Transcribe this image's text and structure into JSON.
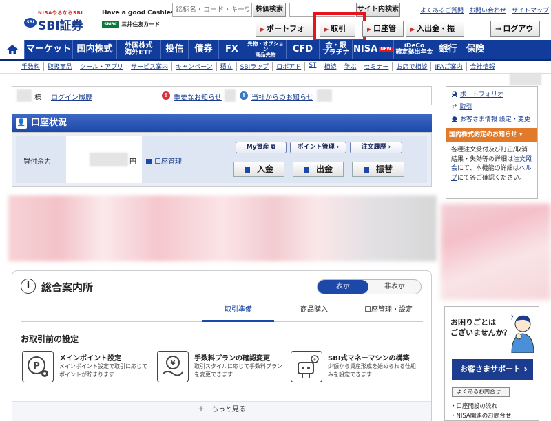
{
  "header": {
    "logo_tag": "NISAやるならSBI",
    "logo_badge": "SBI",
    "logo_name": "SBI証券",
    "cashless": "Have a good Cashless.",
    "smbc_mark": "SMBC",
    "smbc_name": "三井住友カード",
    "stock_search_placeholder": "銘柄名・コード・キーワード",
    "stock_search_button": "株価検索",
    "site_search_button": "サイト内検索",
    "util_links": [
      "よくあるご質問",
      "お問い合わせ",
      "サイトマップ"
    ],
    "portfolio": "ポートフォリオ",
    "trade": "取引",
    "account": "口座管理",
    "transfer": "入出金・振替",
    "logout": "ログアウト"
  },
  "nav": {
    "items": [
      "マーケット",
      "国内株式",
      "外国株式\n海外ETF",
      "投信",
      "債券",
      "FX",
      "先物・オプション\n商品先物",
      "CFD",
      "金・銀\nプラチナ",
      "NISA",
      "iDeCo\n確定拠出年金",
      "銀行",
      "保険"
    ],
    "nisa_badge": "NEW"
  },
  "subnav": [
    "手数料",
    "取扱商品",
    "ツール・アプリ",
    "サービス案内",
    "キャンペーン",
    "積立",
    "SBIラップ",
    "ロボアド",
    "ST",
    "相続",
    "学ぶ",
    "セミナー",
    "お店で相談",
    "IFAご案内",
    "会社情報"
  ],
  "info_bar": {
    "honorific": "様",
    "login_history": "ログイン履歴",
    "important": "重要なお知らせ",
    "company_notice": "当社からのお知らせ"
  },
  "account_status": {
    "title": "口座状況",
    "buy_power_label": "買付余力",
    "yen": "円",
    "manage_link": "口座管理",
    "my_assets": "My資産",
    "point_manage": "ポイント管理",
    "order_history": "注文履歴",
    "deposit": "入金",
    "withdraw": "出金",
    "transfer": "振替"
  },
  "guide": {
    "icon": "i",
    "title": "総合案内所",
    "show": "表示",
    "hide": "非表示",
    "tabs": [
      "取引準備",
      "商品購入",
      "口座管理・設定"
    ],
    "setup_heading": "お取引前の設定",
    "features": [
      {
        "title": "メインポイント設定",
        "desc": "メインポイント設定で取引に応じてポイントが貯まります"
      },
      {
        "title": "手数料プランの確認変更",
        "desc": "取引スタイルに応じて手数料プランを変更できます"
      },
      {
        "title": "SBI式マネーマシンの構築",
        "desc": "少額から資産形成を始められる仕組みを設定できます"
      }
    ],
    "more": "＋　もっと見る"
  },
  "right": {
    "links": [
      "ポートフォリオ",
      "取引",
      "お客さま情報 設定・変更"
    ],
    "notice_title": "国内株式約定のお知らせ",
    "notice_text_1": "各種注文受付及び訂正/取消結果・失効等の詳細は",
    "notice_link_1": "注文照会",
    "notice_text_2": "にて、本機能の詳細は",
    "notice_link_2": "ヘルプ",
    "notice_text_3": "にて各ご確認ください。",
    "help_q": "お困りごとは\nございませんか？",
    "support": "お客さまサポート",
    "faq": "よくあるお問合せ",
    "help_links": [
      "・口座開設の流れ",
      "・NISA関連のお問合せ"
    ]
  },
  "colors": {
    "brand_blue": "#123c9c",
    "highlight_red": "#e8141c",
    "notice_orange": "#e27a2c"
  }
}
